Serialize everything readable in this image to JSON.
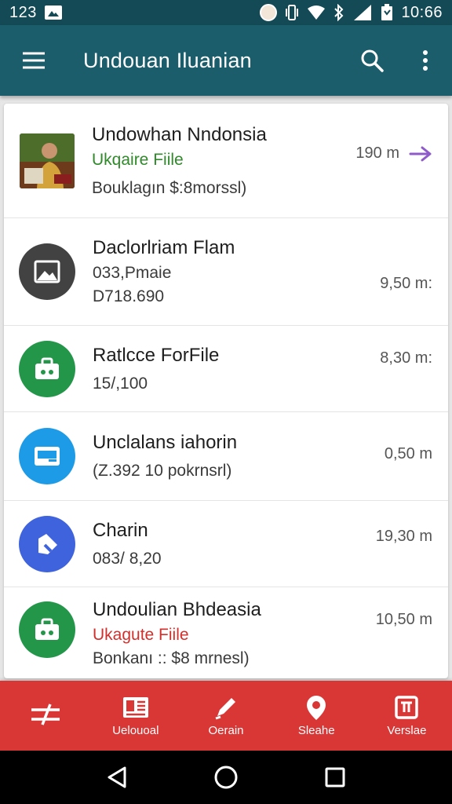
{
  "status_bar": {
    "time_left": "123",
    "time_right": "10:66"
  },
  "toolbar": {
    "title": "Undouan Iluanian"
  },
  "rows": [
    {
      "title": "Undowhan Nndonsia",
      "subtitle": "Ukqaire Fiile",
      "detail": "Bouklagın $:8morssl)",
      "meta": "190 m",
      "icon": "photo-thumbnail"
    },
    {
      "title": "Daclorlriam Flam",
      "subtitle": "033,Pmaie",
      "detail": "D718.690",
      "meta": "9,50 m:",
      "icon": "image-icon",
      "color": "#424242"
    },
    {
      "title": "Ratlcce ForFile",
      "subtitle": "15/,100",
      "meta": "8,30 m:",
      "icon": "briefcase-icon",
      "color": "#23964a"
    },
    {
      "title": "Unclalans iahorin",
      "subtitle": "(Z.392 10 pokrnsrl)",
      "meta": "0,50 m",
      "icon": "card-icon",
      "color": "#1e9be6"
    },
    {
      "title": "Charin",
      "subtitle": "083/ 8,20",
      "meta": "19,30 m",
      "icon": "tag-icon",
      "color": "#3f63dc"
    },
    {
      "title": "Undoulian Bhdeasia",
      "subtitle": "Ukagute Fiile",
      "detail": "Bonkanı :: $8 mrnesl)",
      "meta": "10,50 m",
      "icon": "briefcase-icon",
      "color": "#23964a"
    }
  ],
  "bottom_nav": [
    {
      "label": "",
      "icon": "filter-icon"
    },
    {
      "label": "Uelouoal",
      "icon": "newspaper-icon"
    },
    {
      "label": "Oerain",
      "icon": "pen-icon"
    },
    {
      "label": "Sleahe",
      "icon": "location-pin-icon"
    },
    {
      "label": "Verslae",
      "icon": "calendar-icon"
    }
  ],
  "colors": {
    "toolbar": "#1b5d6b",
    "status_bar": "#134a55",
    "bottom_nav": "#d93636",
    "accent_arrow": "#8f5ac9"
  }
}
